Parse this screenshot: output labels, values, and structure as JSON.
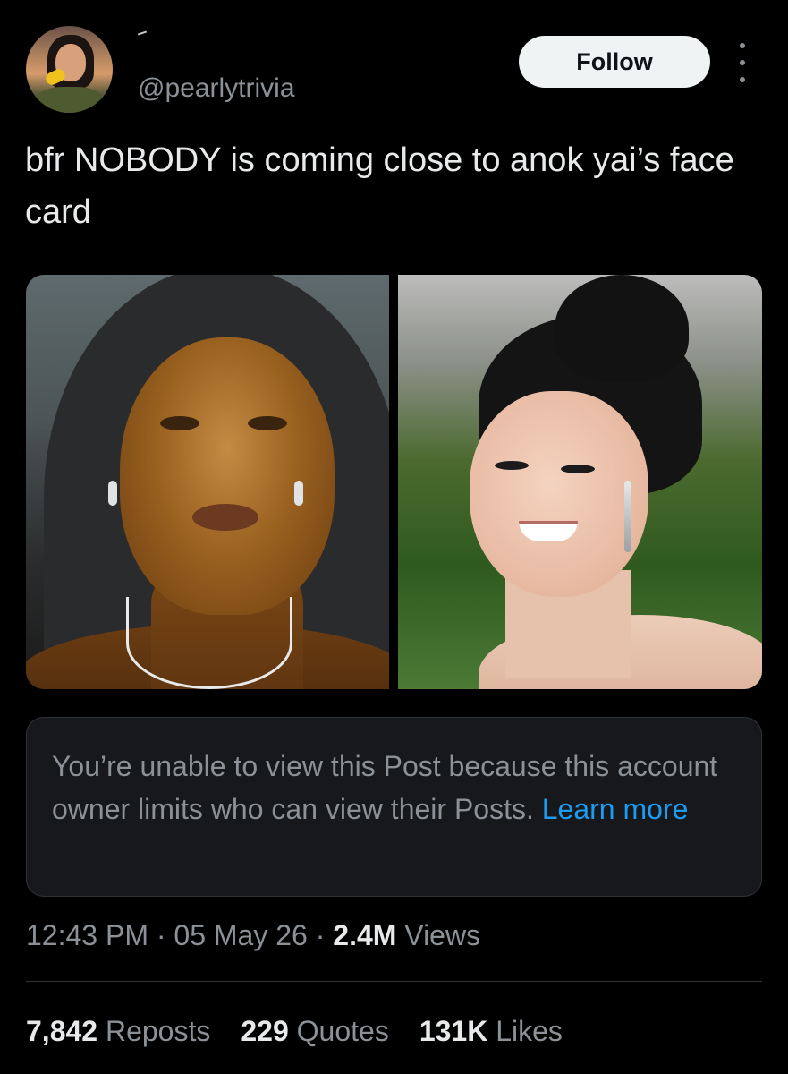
{
  "header": {
    "handle": "@pearlytrivia",
    "follow_label": "Follow",
    "more_icon": "more-options-icon"
  },
  "tweet": {
    "text": "bfr NOBODY is coming close to anok yai’s face card"
  },
  "notice": {
    "message": "You’re unable to view this Post because this account owner limits who can view their Posts.",
    "link_label": "Learn more"
  },
  "meta": {
    "time": "12:43 PM",
    "sep1": "·",
    "date": "05 May 26",
    "sep2": "·",
    "views_count": "2.4M",
    "views_label": "Views"
  },
  "stats": {
    "reposts_count": "7,842",
    "reposts_label": "Reposts",
    "quotes_count": "229",
    "quotes_label": "Quotes",
    "likes_count": "131K",
    "likes_label": "Likes"
  },
  "colors": {
    "background": "#000000",
    "primary_text": "#e7e9ea",
    "secondary_text": "#8b9196",
    "link": "#1d9bf0",
    "follow_button_bg": "#eff3f4"
  }
}
